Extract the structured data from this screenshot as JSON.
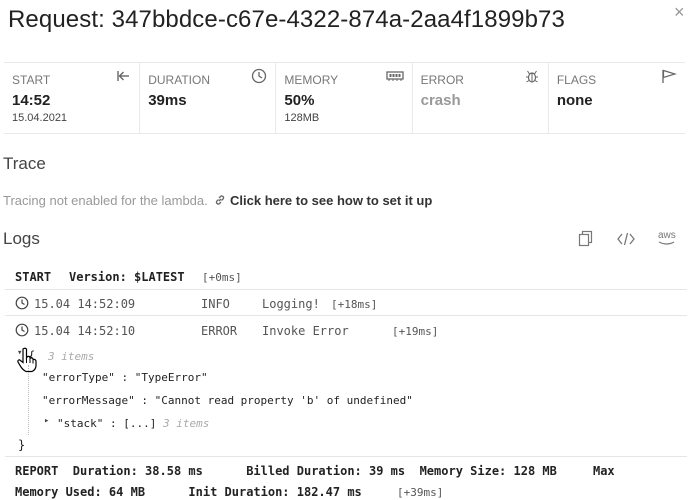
{
  "header": {
    "title": "Request: 347bbdce-c67e-4322-874a-2aa4f1899b73",
    "close_glyph": "×"
  },
  "stats": [
    {
      "label": "START",
      "value": "14:52",
      "sub": "15.04.2021",
      "icon": "jump-to-start-icon"
    },
    {
      "label": "DURATION",
      "value": "39ms",
      "sub": "",
      "icon": "clock-icon"
    },
    {
      "label": "MEMORY",
      "value": "50%",
      "sub": "128MB",
      "icon": "memory-chip-icon"
    },
    {
      "label": "ERROR",
      "value": "crash",
      "sub": "",
      "icon": "bug-icon"
    },
    {
      "label": "FLAGS",
      "value": "none",
      "sub": "",
      "icon": "flag-icon"
    }
  ],
  "trace": {
    "title": "Trace",
    "text": "Tracing not enabled for the lambda.",
    "link": "Click here to see how to set it up"
  },
  "logs": {
    "title": "Logs",
    "tool_icons": [
      "copy-icon",
      "code-icon",
      "aws-icon"
    ],
    "aws_label": "aws",
    "start": {
      "keyword": "START",
      "version": "Version: $LATEST",
      "offset": "[+0ms]"
    },
    "entries": [
      {
        "date": "15.04 14:52:09",
        "level": "INFO",
        "message": "Logging!",
        "offset": "[+18ms]"
      },
      {
        "date": "15.04 14:52:10",
        "level": "ERROR",
        "message": "Invoke Error",
        "offset": "[+19ms]"
      }
    ],
    "json": {
      "open": "{",
      "close": "}",
      "items_hint": "3 items",
      "error_type_key": "\"errorType\"",
      "error_type_value": "\"TypeError\"",
      "error_message_key": "\"errorMessage\"",
      "error_message_value": "\"Cannot read property 'b' of undefined\"",
      "stack_key": "\"stack\"",
      "stack_value": "[...]",
      "stack_hint": "3 items",
      "separator": ":"
    },
    "report": {
      "line1": "REPORT  Duration: 38.58 ms      Billed Duration: 39 ms  Memory Size: 128 MB     Max",
      "line2": "Memory Used: 64 MB      Init Duration: 182.47 ms",
      "offset": "[+39ms]"
    }
  }
}
